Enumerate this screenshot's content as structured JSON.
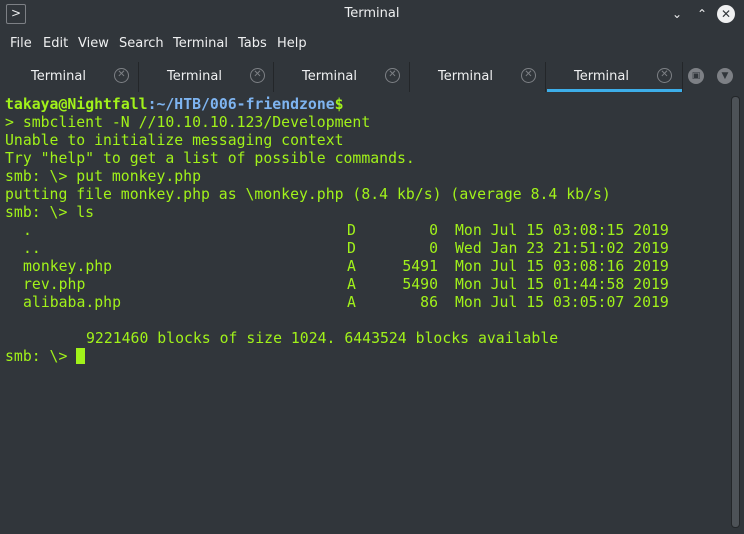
{
  "window": {
    "title": "Terminal",
    "min_glyph": "⌄",
    "max_glyph": "⌃",
    "close_glyph": "✕"
  },
  "menu": [
    "File",
    "Edit",
    "View",
    "Search",
    "Terminal",
    "Tabs",
    "Help"
  ],
  "tabs": [
    {
      "label": "Terminal",
      "active": false
    },
    {
      "label": "Terminal",
      "active": false
    },
    {
      "label": "Terminal",
      "active": false
    },
    {
      "label": "Terminal",
      "active": false
    },
    {
      "label": "Terminal",
      "active": true
    }
  ],
  "tab_close_glyph": "✕",
  "colors": {
    "text": "#a1f21a",
    "path": "#7eb4f0",
    "accent": "#3daee9",
    "background": "#31363b"
  },
  "terminal": {
    "prompt_user": "takaya",
    "prompt_at": "@",
    "prompt_host": "Nightfall",
    "prompt_colon": ":",
    "prompt_path": "~/HTB/006-friendzone",
    "prompt_dollar": "$",
    "lines": [
      "> smbclient -N //10.10.10.123/Development",
      "Unable to initialize messaging context",
      "Try \"help\" to get a list of possible commands.",
      "smb: \\> put monkey.php",
      "putting file monkey.php as \\monkey.php (8.4 kb/s) (average 8.4 kb/s)",
      "smb: \\> ls"
    ],
    "listing": [
      {
        "name": ".",
        "attr": "D",
        "size": "0",
        "date": "Mon Jul 15 03:08:15 2019"
      },
      {
        "name": "..",
        "attr": "D",
        "size": "0",
        "date": "Wed Jan 23 21:51:02 2019"
      },
      {
        "name": "monkey.php",
        "attr": "A",
        "size": "5491",
        "date": "Mon Jul 15 03:08:16 2019"
      },
      {
        "name": "rev.php",
        "attr": "A",
        "size": "5490",
        "date": "Mon Jul 15 01:44:58 2019"
      },
      {
        "name": "alibaba.php",
        "attr": "A",
        "size": "86",
        "date": "Mon Jul 15 03:05:07 2019"
      }
    ],
    "blocks_line": "9221460 blocks of size 1024. 6443524 blocks available",
    "final_prompt": "smb: \\> "
  }
}
